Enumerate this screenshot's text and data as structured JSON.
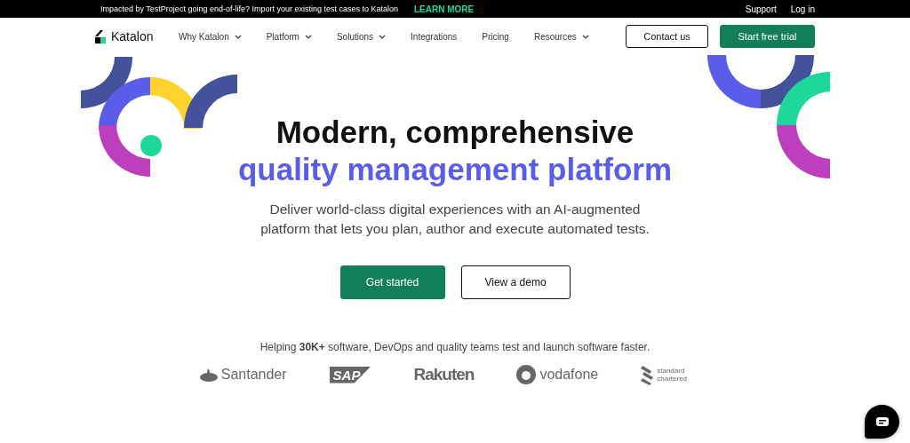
{
  "announcement": {
    "text": "Impacted by TestProject going end-of-life? Import your existing test cases to Katalon",
    "link": "LEARN MORE",
    "right_links": [
      "Support",
      "Log in"
    ]
  },
  "nav": {
    "brand": "Katalon",
    "items": [
      {
        "label": "Why Katalon",
        "has_menu": true
      },
      {
        "label": "Platform",
        "has_menu": true
      },
      {
        "label": "Solutions",
        "has_menu": true
      },
      {
        "label": "Integrations",
        "has_menu": false
      },
      {
        "label": "Pricing",
        "has_menu": false
      },
      {
        "label": "Resources",
        "has_menu": true
      }
    ],
    "buttons": [
      {
        "label": "Contact us",
        "kind": "outline"
      },
      {
        "label": "Start free trial",
        "kind": "primary"
      }
    ]
  },
  "hero": {
    "title_line_1": "Modern, comprehensive",
    "title_line_2": "quality management platform",
    "subtitle": "Deliver world-class digital experiences with an AI-augmented platform that lets you plan, author and execute automated tests.",
    "buttons": [
      {
        "label": "Get started",
        "kind": "primary"
      },
      {
        "label": "View a demo",
        "kind": "outline"
      }
    ]
  },
  "customers": {
    "text": "Helping **30K+** software, DevOps and quality teams test and launch software faster.",
    "logos": [
      {
        "name": "Santander",
        "kind": "santander"
      },
      {
        "name": "SAP",
        "kind": "sap"
      },
      {
        "name": "Rakuten",
        "kind": "rakuten"
      },
      {
        "name": "vodafone",
        "kind": "vodafone"
      },
      {
        "name": "standard chartered",
        "kind": "sc"
      }
    ]
  }
}
